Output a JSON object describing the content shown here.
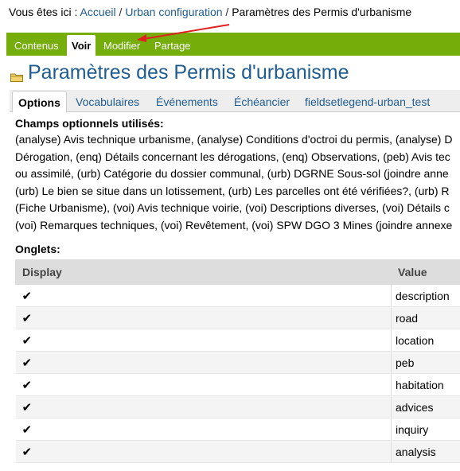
{
  "breadcrumb": {
    "prefix": "Vous êtes ici :",
    "items": [
      {
        "label": "Accueil"
      },
      {
        "label": "Urban configuration"
      },
      {
        "label": "Paramètres des Permis d'urbanisme"
      }
    ],
    "separator": "/"
  },
  "content_tabs": [
    {
      "label": "Contenus",
      "active": false
    },
    {
      "label": "Voir",
      "active": true
    },
    {
      "label": "Modifier",
      "active": false
    },
    {
      "label": "Partage",
      "active": false
    }
  ],
  "page_title": "Paramètres des Permis d'urbanisme",
  "sub_tabs": [
    {
      "label": "Options",
      "active": true
    },
    {
      "label": "Vocabulaires",
      "active": false
    },
    {
      "label": "Événements",
      "active": false
    },
    {
      "label": "Échéancier",
      "active": false
    },
    {
      "label": "fieldsetlegend-urban_test",
      "active": false
    }
  ],
  "champs": {
    "label": "Champs optionnels utilisés:",
    "lines": [
      "(analyse) Avis technique urbanisme, (analyse) Conditions d'octroi du permis, (analyse) D",
      "Dérogation, (enq) Détails concernant les dérogations, (enq) Observations, (peb) Avis tec",
      "ou assimilé, (urb) Catégorie du dossier communal, (urb) DGRNE Sous-sol (joindre anne",
      "(urb) Le bien se situe dans un lotissement, (urb) Les parcelles ont été vérifiées?, (urb) R",
      "(Fiche Urbanisme), (voi) Avis technique voirie, (voi) Descriptions diverses, (voi) Détails c",
      "(voi) Remarques techniques, (voi) Revêtement, (voi) SPW DGO 3 Mines (joindre annexe"
    ]
  },
  "onglets": {
    "label": "Onglets:",
    "columns": [
      "Display",
      "Value"
    ],
    "check_glyph": "✔",
    "rows": [
      {
        "display": true,
        "value": "description"
      },
      {
        "display": true,
        "value": "road"
      },
      {
        "display": true,
        "value": "location"
      },
      {
        "display": true,
        "value": "peb"
      },
      {
        "display": true,
        "value": "habitation"
      },
      {
        "display": true,
        "value": "advices"
      },
      {
        "display": true,
        "value": "inquiry"
      },
      {
        "display": true,
        "value": "analysis"
      }
    ]
  },
  "colors": {
    "accent_green": "#75ad0a",
    "link_blue": "#205c90",
    "annotation_arrow": "#e02020"
  }
}
